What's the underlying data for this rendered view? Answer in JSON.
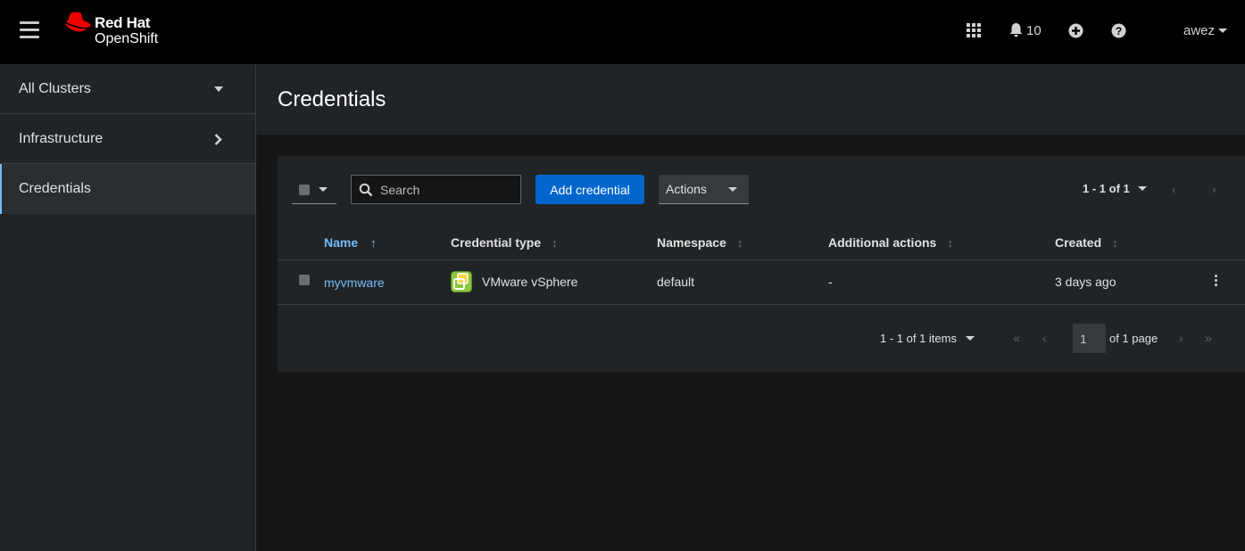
{
  "masthead": {
    "brand_line1": "Red Hat",
    "brand_line2": "OpenShift",
    "notification_count": "10",
    "user_name": "awez",
    "icons": [
      "hamburger-icon",
      "red-hat-logo-icon",
      "app-launcher-icon",
      "bell-icon",
      "plus-circle-icon",
      "help-icon",
      "caret-down-icon"
    ]
  },
  "sidebar": {
    "items": [
      {
        "label": "All Clusters",
        "icon": "caret-down-icon"
      },
      {
        "label": "Infrastructure",
        "icon": "chevron-right-icon"
      },
      {
        "label": "Credentials",
        "active": true
      }
    ]
  },
  "page": {
    "title": "Credentials"
  },
  "toolbar": {
    "search_placeholder": "Search",
    "add_label": "Add credential",
    "actions_label": "Actions",
    "pagination_top": "1 - 1 of 1"
  },
  "table": {
    "columns": [
      "Name",
      "Credential type",
      "Namespace",
      "Additional actions",
      "Created"
    ],
    "sorted_column": "Name",
    "rows": [
      {
        "name": "myvmware",
        "credential_type": "VMware vSphere",
        "namespace": "default",
        "additional_actions": "-",
        "created": "3 days ago"
      }
    ]
  },
  "pagination_bottom": {
    "items_label": "1 - 1 of 1 items",
    "page_value": "1",
    "of_pages": "of 1 page"
  },
  "colors": {
    "masthead_bg": "#000000",
    "panel_bg": "#212427",
    "page_bg": "#151515",
    "primary_button": "#0066cc",
    "link": "#73bcf7",
    "redhat_red": "#ee0000"
  }
}
